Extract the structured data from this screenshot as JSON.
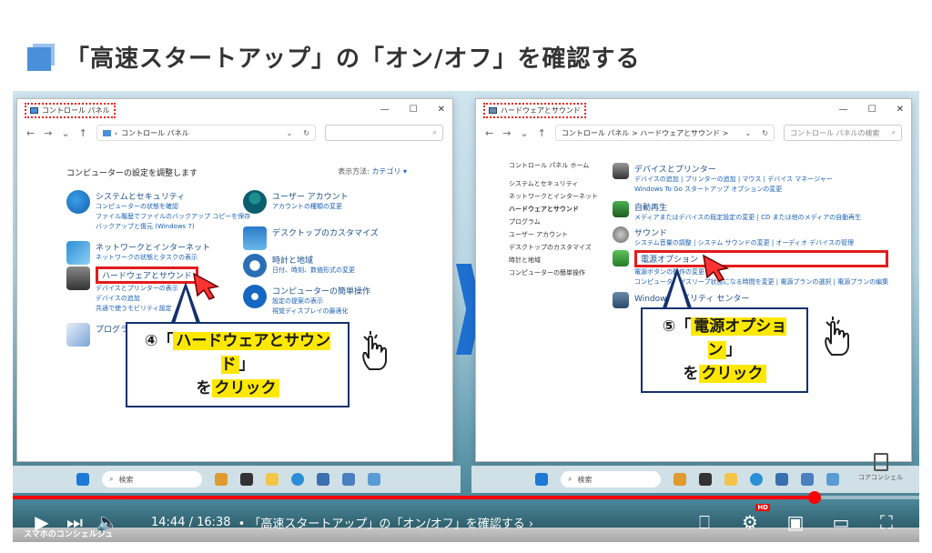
{
  "slide": {
    "title": "「高速スタートアップ」の「オン/オフ」を確認する"
  },
  "left_window": {
    "title": "コントロール パネル",
    "address": "コントロール パネル",
    "heading": "コンピューターの設定を調整します",
    "view_label": "表示方法:",
    "view_value": "カテゴリ ▾",
    "categories": [
      {
        "title": "システムとセキュリティ",
        "links": [
          "コンピューターの状態を確認",
          "ファイル履歴でファイルのバックアップ コピーを保存",
          "バックアップと復元 (Windows 7)"
        ]
      },
      {
        "title": "ネットワークとインターネット",
        "links": [
          "ネットワークの状態とタスクの表示"
        ]
      },
      {
        "title": "ハードウェアとサウンド",
        "links": [
          "デバイスとプリンターの表示",
          "デバイスの追加",
          "共通で使うモビリティ設定"
        ]
      },
      {
        "title": "プログラム",
        "links": []
      },
      {
        "title": "ユーザー アカウント",
        "links": [
          "アカウントの種類の変更"
        ]
      },
      {
        "title": "デスクトップのカスタマイズ",
        "links": []
      },
      {
        "title": "時計と地域",
        "links": [
          "日付、時刻、数値形式の変更"
        ]
      },
      {
        "title": "コンピューターの簡単操作",
        "links": [
          "設定の提案の表示",
          "視覚ディスプレイの最適化"
        ]
      }
    ],
    "callout_step": "④「",
    "callout_target": "ハードウェアとサウンド",
    "callout_end": "」",
    "callout_wo": "を",
    "callout_click": "クリック",
    "taskbar_search": "検索"
  },
  "right_window": {
    "title": "ハードウェアとサウンド",
    "address": "コントロール パネル  >  ハードウェアとサウンド  >",
    "search_placeholder": "コントロール パネルの検索",
    "sidebar": [
      "コントロール パネル ホーム",
      "システムとセキュリティ",
      "ネットワークとインターネット",
      "ハードウェアとサウンド",
      "プログラム",
      "ユーザー アカウント",
      "デスクトップのカスタマイズ",
      "時計と地域",
      "コンピューターの簡単操作"
    ],
    "sections": [
      {
        "title": "デバイスとプリンター",
        "links": "デバイスの追加 | プリンターの追加 | マウス | デバイス マネージャー",
        "links2": "Windows To Go スタートアップ オプションの変更"
      },
      {
        "title": "自動再生",
        "links": "メディアまたはデバイスの既定設定の変更 | CD または他のメディアの自動再生",
        "links2": ""
      },
      {
        "title": "サウンド",
        "links": "システム音量の調整 | システム サウンドの変更 | オーディオ デバイスの管理",
        "links2": ""
      },
      {
        "title": "電源オプション",
        "links": "電源ボタンの動作の変更",
        "links2": "コンピューターがスリープ状態になる時間を変更 | 電源プランの選択 | 電源プランの編集"
      },
      {
        "title": "Windows モビリティ センター",
        "links": "",
        "links2": ""
      }
    ],
    "callout_step": "⑤「",
    "callout_target": "電源オプション",
    "callout_end": "」",
    "callout_wo": "を",
    "callout_click": "クリック",
    "taskbar_search": "検索",
    "brand": "コアコンシェル"
  },
  "player": {
    "time": "14:44 / 16:38",
    "chapter": "•  「高速スタートアップ」の「オン/オフ」を確認する  ›",
    "progress_fraction": 0.885,
    "channel": "スマホのコンシェルジュ",
    "hd": "HD"
  }
}
